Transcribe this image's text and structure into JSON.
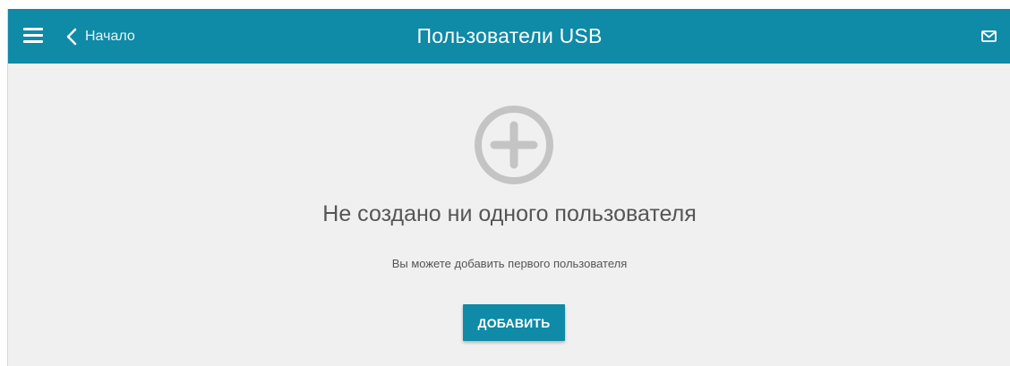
{
  "header": {
    "back_label": "Начало",
    "title": "Пользователи USB",
    "menu_icon": "hamburger-menu-icon",
    "back_icon": "chevron-left-icon",
    "mail_icon": "envelope-icon"
  },
  "empty_state": {
    "icon": "plus-circle-icon",
    "title": "Не создано ни одного пользователя",
    "hint": "Вы можете добавить первого пользователя",
    "add_label": "ДОБАВИТЬ"
  },
  "colors": {
    "accent": "#0f8aa7",
    "background": "#f0f0f0",
    "icon_gray": "#c4c4c4",
    "text_gray": "#555555"
  }
}
